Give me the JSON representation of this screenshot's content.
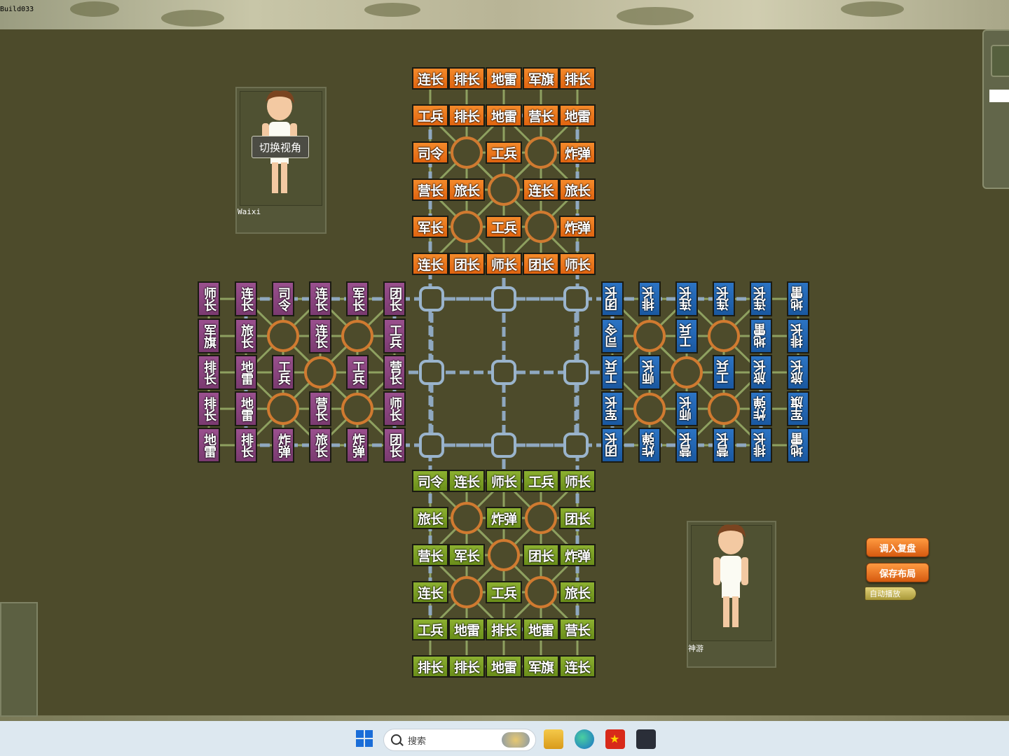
{
  "window": {
    "title": "Build033"
  },
  "players": {
    "top_left": {
      "name": "Waixi",
      "switch_view_label": "切换视角"
    },
    "bottom_right": {
      "name": "神游"
    }
  },
  "controls": {
    "load_replay": "调入复盘",
    "save_layout": "保存布局",
    "autoplay": "自动播放"
  },
  "taskbar": {
    "search_placeholder": "搜索"
  },
  "colors": {
    "orange": "#e8741c",
    "green": "#7ca024",
    "purple": "#8a447e",
    "blue": "#2266b4",
    "rail": "#8fa8c0",
    "camp": "#d07a30"
  },
  "board": {
    "orange": [
      [
        "连长",
        "排长",
        "地雷",
        "军旗",
        "排长"
      ],
      [
        "工兵",
        "排长",
        "地雷",
        "营长",
        "地雷"
      ],
      [
        "司令",
        "",
        "工兵",
        "",
        "炸弹"
      ],
      [
        "营长",
        "旅长",
        "",
        "连长",
        "旅长"
      ],
      [
        "军长",
        "",
        "工兵",
        "",
        "炸弹"
      ],
      [
        "连长",
        "团长",
        "师长",
        "团长",
        "师长"
      ]
    ],
    "green": [
      [
        "司令",
        "连长",
        "师长",
        "工兵",
        "师长"
      ],
      [
        "旅长",
        "",
        "炸弹",
        "",
        "团长"
      ],
      [
        "营长",
        "军长",
        "",
        "团长",
        "炸弹"
      ],
      [
        "连长",
        "",
        "工兵",
        "",
        "旅长"
      ],
      [
        "工兵",
        "地雷",
        "排长",
        "地雷",
        "营长"
      ],
      [
        "排长",
        "排长",
        "地雷",
        "军旗",
        "连长"
      ]
    ],
    "purple": [
      [
        "师长",
        "连长",
        "司令",
        "连长",
        "军长",
        "团长"
      ],
      [
        "军旗",
        "旅长",
        "",
        "连长",
        "",
        "工兵"
      ],
      [
        "排长",
        "地雷",
        "工兵",
        "",
        "工兵",
        "营长"
      ],
      [
        "排长",
        "地雷",
        "",
        "营长",
        "",
        "师长"
      ],
      [
        "地雷",
        "排长",
        "炸弹",
        "旅长",
        "炸弹",
        "团长"
      ]
    ],
    "blue": [
      [
        "团长",
        "排长",
        "连长",
        "连长",
        "连长",
        "地雷"
      ],
      [
        "司令",
        "",
        "工兵",
        "",
        "地雷",
        "排长"
      ],
      [
        "工兵",
        "师长",
        "",
        "工兵",
        "旅长",
        "旅长"
      ],
      [
        "军长",
        "",
        "师长",
        "",
        "炸弹",
        "军旗"
      ],
      [
        "团长",
        "炸弹",
        "营长",
        "营长",
        "排长",
        "地雷"
      ]
    ]
  }
}
